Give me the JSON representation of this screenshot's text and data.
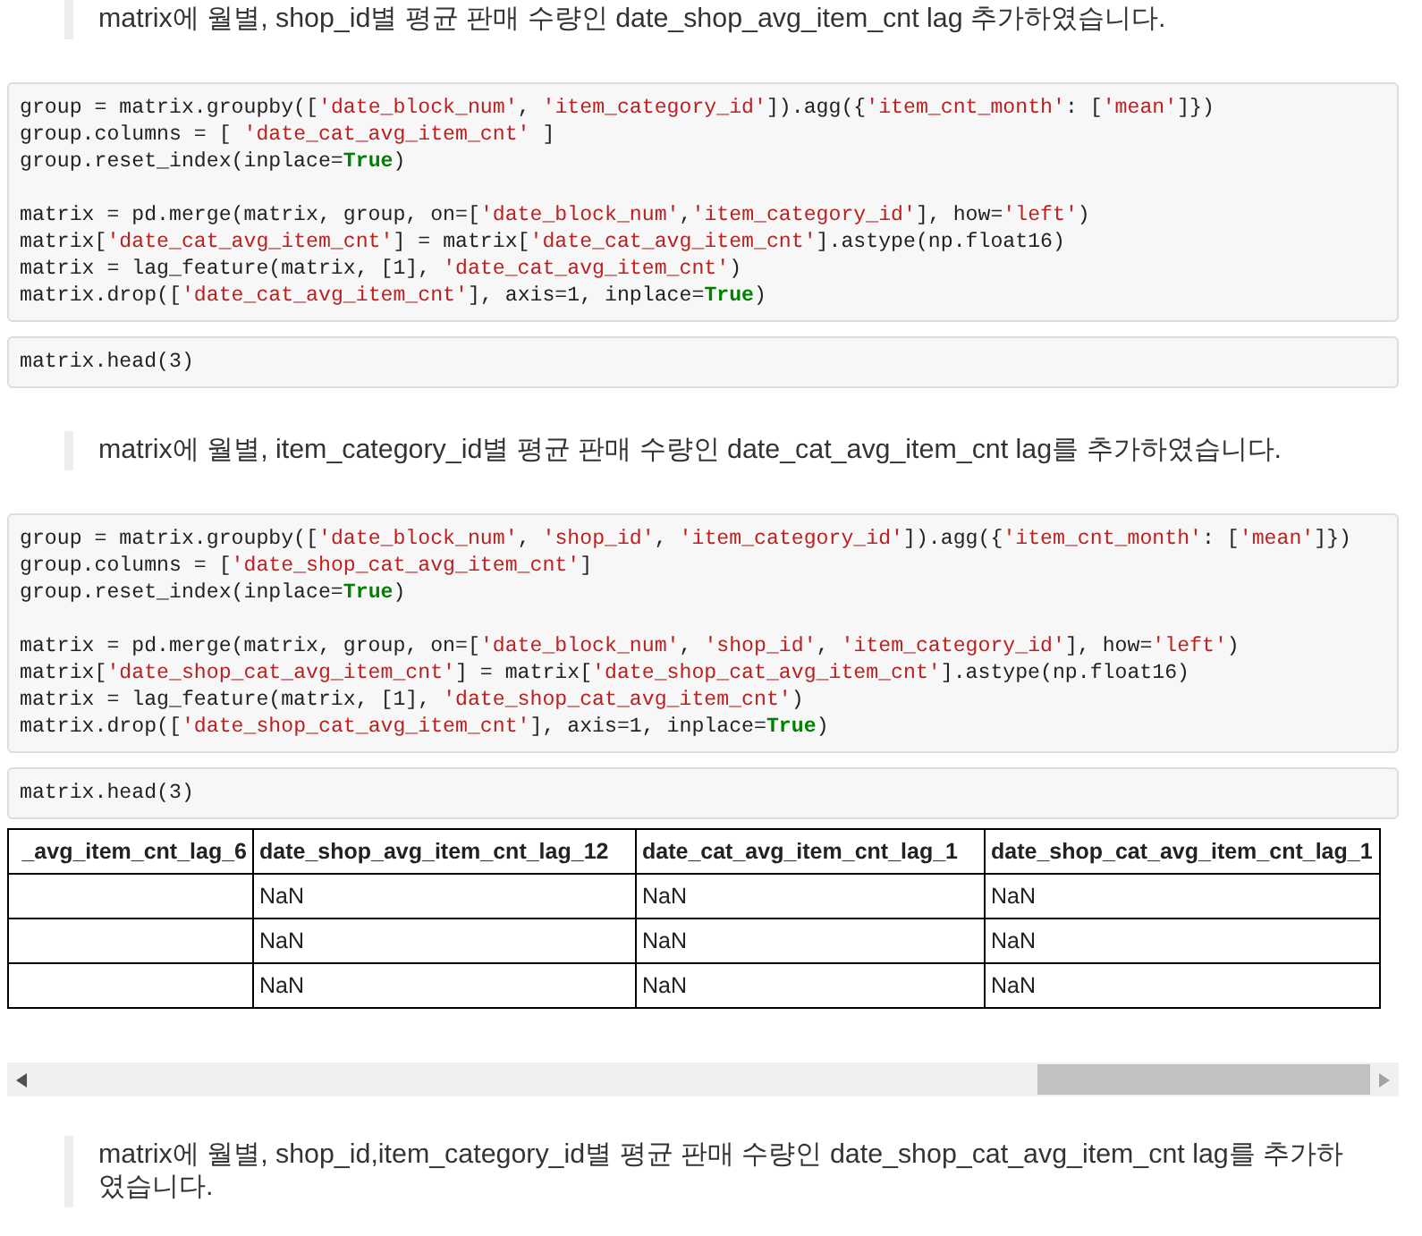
{
  "cells": [
    {
      "kind": "quote",
      "text": "matrix에 월별, shop_id별 평균 판매 수량인 date_shop_avg_item_cnt lag 추가하였습니다."
    },
    {
      "kind": "code",
      "groups": [
        [
          [
            {
              "text": "group = matrix.groupby([",
              "kind": "plain"
            },
            {
              "text": "'date_block_num'",
              "kind": "string"
            },
            {
              "text": ", ",
              "kind": "plain"
            },
            {
              "text": "'item_category_id'",
              "kind": "string"
            },
            {
              "text": "]).agg({",
              "kind": "plain"
            },
            {
              "text": "'item_cnt_month'",
              "kind": "string"
            },
            {
              "text": ": [",
              "kind": "plain"
            },
            {
              "text": "'mean'",
              "kind": "string"
            },
            {
              "text": "]})",
              "kind": "plain"
            }
          ],
          [
            {
              "text": "group.columns = [ ",
              "kind": "plain"
            },
            {
              "text": "'date_cat_avg_item_cnt'",
              "kind": "string"
            },
            {
              "text": " ]",
              "kind": "plain"
            }
          ],
          [
            {
              "text": "group.reset_index(inplace=",
              "kind": "plain"
            },
            {
              "text": "True",
              "kind": "keyword"
            },
            {
              "text": ")",
              "kind": "plain"
            }
          ]
        ],
        [
          [
            {
              "text": "matrix = pd.merge(matrix, group, on=[",
              "kind": "plain"
            },
            {
              "text": "'date_block_num'",
              "kind": "string"
            },
            {
              "text": ",",
              "kind": "plain"
            },
            {
              "text": "'item_category_id'",
              "kind": "string"
            },
            {
              "text": "], how=",
              "kind": "plain"
            },
            {
              "text": "'left'",
              "kind": "string"
            },
            {
              "text": ")",
              "kind": "plain"
            }
          ],
          [
            {
              "text": "matrix[",
              "kind": "plain"
            },
            {
              "text": "'date_cat_avg_item_cnt'",
              "kind": "string"
            },
            {
              "text": "] = matrix[",
              "kind": "plain"
            },
            {
              "text": "'date_cat_avg_item_cnt'",
              "kind": "string"
            },
            {
              "text": "].astype(np.float16)",
              "kind": "plain"
            }
          ],
          [
            {
              "text": "matrix = lag_feature(matrix, [1], ",
              "kind": "plain"
            },
            {
              "text": "'date_cat_avg_item_cnt'",
              "kind": "string"
            },
            {
              "text": ")",
              "kind": "plain"
            }
          ],
          [
            {
              "text": "matrix.drop([",
              "kind": "plain"
            },
            {
              "text": "'date_cat_avg_item_cnt'",
              "kind": "string"
            },
            {
              "text": "], axis=1, inplace=",
              "kind": "plain"
            },
            {
              "text": "True",
              "kind": "keyword"
            },
            {
              "text": ")",
              "kind": "plain"
            }
          ]
        ]
      ]
    },
    {
      "kind": "code",
      "groups": [
        [
          [
            {
              "text": "matrix.head(3)",
              "kind": "plain"
            }
          ]
        ]
      ]
    },
    {
      "kind": "quote",
      "text": "matrix에 월별, item_category_id별 평균 판매 수량인 date_cat_avg_item_cnt lag를 추가하였습니다."
    },
    {
      "kind": "code",
      "groups": [
        [
          [
            {
              "text": "group = matrix.groupby([",
              "kind": "plain"
            },
            {
              "text": "'date_block_num'",
              "kind": "string"
            },
            {
              "text": ", ",
              "kind": "plain"
            },
            {
              "text": "'shop_id'",
              "kind": "string"
            },
            {
              "text": ", ",
              "kind": "plain"
            },
            {
              "text": "'item_category_id'",
              "kind": "string"
            },
            {
              "text": "]).agg({",
              "kind": "plain"
            },
            {
              "text": "'item_cnt_month'",
              "kind": "string"
            },
            {
              "text": ": [",
              "kind": "plain"
            },
            {
              "text": "'mean'",
              "kind": "string"
            },
            {
              "text": "]})",
              "kind": "plain"
            }
          ],
          [
            {
              "text": "group.columns = [",
              "kind": "plain"
            },
            {
              "text": "'date_shop_cat_avg_item_cnt'",
              "kind": "string"
            },
            {
              "text": "]",
              "kind": "plain"
            }
          ],
          [
            {
              "text": "group.reset_index(inplace=",
              "kind": "plain"
            },
            {
              "text": "True",
              "kind": "keyword"
            },
            {
              "text": ")",
              "kind": "plain"
            }
          ]
        ],
        [
          [
            {
              "text": "matrix = pd.merge(matrix, group, on=[",
              "kind": "plain"
            },
            {
              "text": "'date_block_num'",
              "kind": "string"
            },
            {
              "text": ", ",
              "kind": "plain"
            },
            {
              "text": "'shop_id'",
              "kind": "string"
            },
            {
              "text": ", ",
              "kind": "plain"
            },
            {
              "text": "'item_category_id'",
              "kind": "string"
            },
            {
              "text": "], how=",
              "kind": "plain"
            },
            {
              "text": "'left'",
              "kind": "string"
            },
            {
              "text": ")",
              "kind": "plain"
            }
          ],
          [
            {
              "text": "matrix[",
              "kind": "plain"
            },
            {
              "text": "'date_shop_cat_avg_item_cnt'",
              "kind": "string"
            },
            {
              "text": "] = matrix[",
              "kind": "plain"
            },
            {
              "text": "'date_shop_cat_avg_item_cnt'",
              "kind": "string"
            },
            {
              "text": "].astype(np.float16)",
              "kind": "plain"
            }
          ],
          [
            {
              "text": "matrix = lag_feature(matrix, [1], ",
              "kind": "plain"
            },
            {
              "text": "'date_shop_cat_avg_item_cnt'",
              "kind": "string"
            },
            {
              "text": ")",
              "kind": "plain"
            }
          ],
          [
            {
              "text": "matrix.drop([",
              "kind": "plain"
            },
            {
              "text": "'date_shop_cat_avg_item_cnt'",
              "kind": "string"
            },
            {
              "text": "], axis=1, inplace=",
              "kind": "plain"
            },
            {
              "text": "True",
              "kind": "keyword"
            },
            {
              "text": ")",
              "kind": "plain"
            }
          ]
        ]
      ]
    },
    {
      "kind": "code",
      "groups": [
        [
          [
            {
              "text": "matrix.head(3)",
              "kind": "plain"
            }
          ]
        ]
      ]
    },
    {
      "kind": "table",
      "columns": [
        "_avg_item_cnt_lag_6",
        "date_shop_avg_item_cnt_lag_12",
        "date_cat_avg_item_cnt_lag_1",
        "date_shop_cat_avg_item_cnt_lag_1"
      ],
      "rows": [
        {
          "cells": [
            "",
            "NaN",
            "NaN",
            "NaN"
          ]
        },
        {
          "cells": [
            "",
            "NaN",
            "NaN",
            "NaN"
          ]
        },
        {
          "cells": [
            "",
            "NaN",
            "NaN",
            "NaN"
          ]
        }
      ]
    },
    {
      "kind": "quote",
      "text": "matrix에 월별, shop_id,item_category_id별 평균 판매 수량인 date_shop_cat_avg_item_cnt lag를 추가하였습니다."
    }
  ]
}
